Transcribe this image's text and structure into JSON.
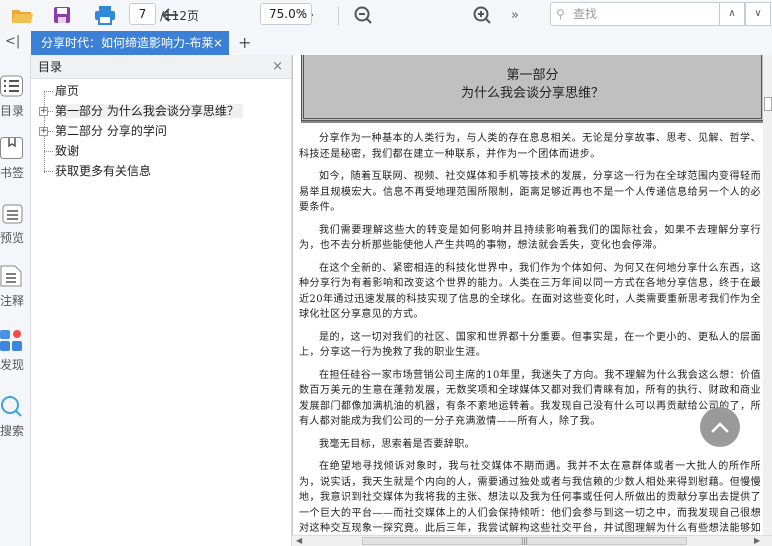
{
  "toolbar": {
    "page_current": "7",
    "page_total": "/112页",
    "zoom_level": "75.0%",
    "search_placeholder": "查找",
    "more": "»"
  },
  "tabs": [
    {
      "label": "分享时代：如何缔造影响力-布莱",
      "close": "×"
    }
  ],
  "tab_add": "+",
  "sidebar": {
    "items": [
      {
        "label": "目录"
      },
      {
        "label": "书签"
      },
      {
        "label": "预览"
      },
      {
        "label": "注释"
      },
      {
        "label": "发现"
      },
      {
        "label": "搜索"
      }
    ]
  },
  "toc": {
    "title": "目录",
    "close": "×",
    "items": [
      {
        "label": "扉页",
        "expandable": false
      },
      {
        "label": "第一部分 为什么我会谈分享思维？",
        "expandable": true,
        "selected": true
      },
      {
        "label": "第二部分 分享的学问",
        "expandable": true
      },
      {
        "label": "致谢",
        "expandable": false
      },
      {
        "label": "获取更多有关信息",
        "expandable": false
      }
    ]
  },
  "document": {
    "chapter_number": "第一部分",
    "chapter_title": "为什么我会谈分享思维？",
    "paragraphs": [
      "分享作为一种基本的人类行为，与人类的存在息息相关。无论是分享故事、思考、见解、哲学、科技还是秘密，我们都在建立一种联系，并作为一个团体而进步。",
      "如今，随着互联网、视频、社交媒体和手机等技术的发展，分享这一行为在全球范围内变得轻而易举且规模宏大。信息不再受地理范围所限制，距离足够近再也不是一个人传递信息给另一个人的必要条件。",
      "我们需要理解这些大的转变是如何影响并且持续影响着我们的国际社会，如果不去理解分享行为，也不去分析那些能使他人产生共鸣的事物，想法就会丢失，变化也会停滞。",
      "在这个全新的、紧密相连的科技化世界中，我们作为个体如何、为何又在何地分享什么东西，这种分享行为有着影响和改变这个世界的能力。人类在三万年间以同一方式在各地分享信息，终于在最近20年通过迅速发展的科技实现了信息的全球化。在面对这些变化时，人类需要重新思考我们作为全球化社区分享意见的方式。",
      "是的，这一切对我们的社区、国家和世界都十分重要。但事实是，在一个更小的、更私人的层面上，分享这一行为挽救了我的职业生涯。",
      "在担任硅谷一家市场营销公司主席的10年里，我迷失了方向。我不理解为什么我会这么想：价值数百万美元的生意在蓬勃发展，无数奖项和全球媒体又都对我们青睐有加，所有的执行、财政和商业发展部门都像加满机油的机器，有条不紊地运转着。我发现自己没有什么可以再贡献给公司的了，所有人都对能成为我们公司的一分子充满激情——所有人，除了我。",
      "我毫无目标，思索着是否要辞职。",
      "在绝望地寻找倾诉对象时，我与社交媒体不期而遇。我并不太在意群体或者一大批人的所作所为，说实话，我天生就是个内向的人，需要通过独处或者与我信赖的少数人相处来得到慰藉。但慢慢地，我意识到社交媒体为我将我的主张、想法以及我为任何事或任何人所做出的贡献分享出去提供了一个巨大的平台——而社交媒体上的人们会保持倾听：他们会参与到这一切之中，而我发现自己很想对这种交互现象一探究竟。此后三年，我尝试解构这些社交平台，并试图理解为什么有些想法能够如野火般蔓延，而有些却被"
    ]
  },
  "colors": {
    "accent": "#3c7fd6",
    "chapter_bg": "#c0c0c0"
  }
}
